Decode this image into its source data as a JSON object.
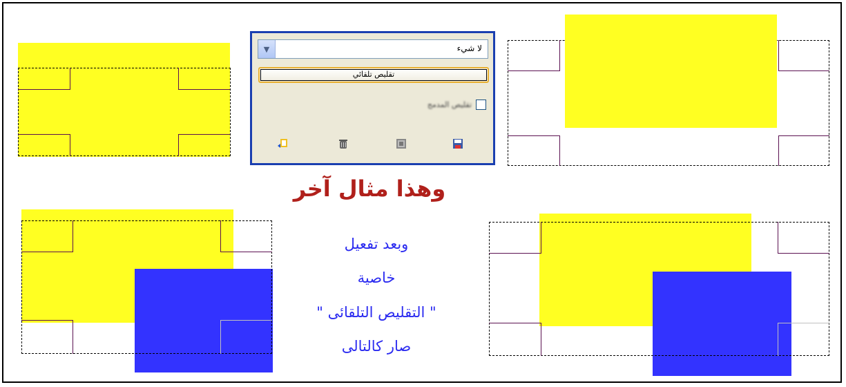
{
  "panel": {
    "combo_value": "لا شيء",
    "shrink_button": "تقليص تلقائي",
    "checkbox_label": "تقليص المدمج"
  },
  "icons": [
    "save-icon",
    "restore-icon",
    "delete-icon",
    "reset-icon"
  ],
  "title": "وهذا مثال آخر",
  "description": {
    "line1": "وبعد تفعيل",
    "line2": "خاصية",
    "line3": "\" التقليص التلقائى \"",
    "line4": "صار كالتالى"
  },
  "colors": {
    "yellow": "#ffff22",
    "blue": "#3333ff",
    "title": "#b0201b",
    "description": "#2b2bf0",
    "panel_border": "#1a3fb0"
  }
}
